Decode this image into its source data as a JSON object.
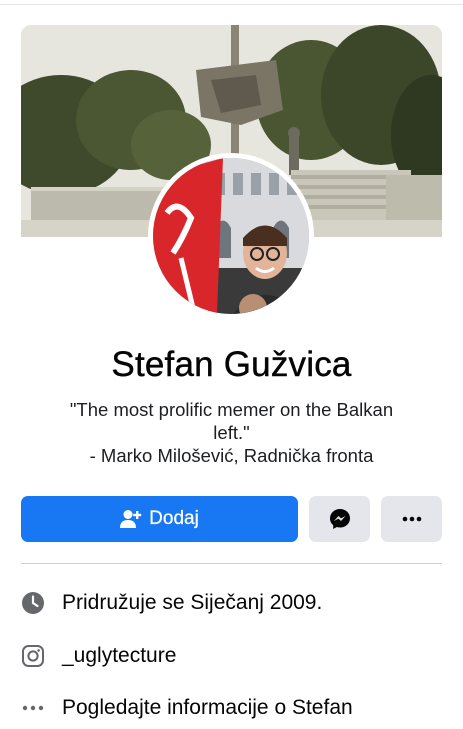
{
  "profile": {
    "name": "Stefan Gužvica",
    "bio_line1": "\"The most prolific memer on the Balkan",
    "bio_line2": "left.\"",
    "bio_line3": "- Marko Milošević, Radnička fronta"
  },
  "actions": {
    "add_label": "Dodaj",
    "add_icon": "add-friend-icon",
    "message_icon": "messenger-icon",
    "more_icon": "more-dots-icon"
  },
  "info": {
    "joined": "Pridružuje se Siječanj 2009.",
    "joined_icon": "clock-icon",
    "instagram": "_uglytecture",
    "instagram_icon": "instagram-icon",
    "about": "Pogledajte informacije o Stefan",
    "about_icon": "more-dots-icon"
  },
  "colors": {
    "primary": "#1877f2",
    "secondary_button": "#e4e6eb",
    "text": "#050505",
    "icon_gray": "#65676b"
  }
}
